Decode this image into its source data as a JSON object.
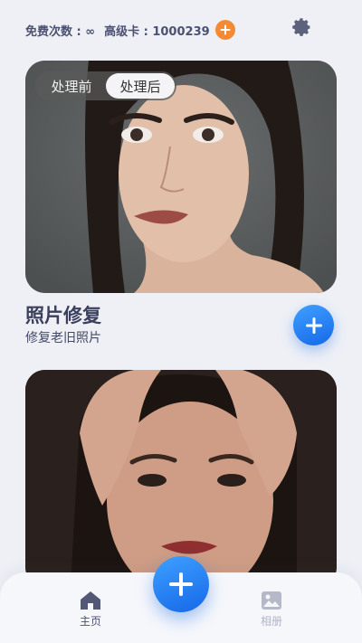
{
  "header": {
    "free_count_label": "免费次数 : ∞",
    "premium_card_label": "高级卡 : 1000239",
    "add_icon": "plus-icon",
    "settings_icon": "gear-icon"
  },
  "compare_toggle": {
    "options": [
      "处理前",
      "处理后"
    ],
    "active": "处理后"
  },
  "feature_card": {
    "title": "照片修复",
    "subtitle": "修复老旧照片",
    "add_icon": "plus-icon"
  },
  "bottom_nav": {
    "items": [
      {
        "label": "主页",
        "icon": "home-icon",
        "active": true
      },
      {
        "label": "相册",
        "icon": "gallery-icon",
        "active": false
      }
    ],
    "center_icon": "plus-icon"
  },
  "colors": {
    "accent_blue": "#1f7ef0",
    "accent_orange": "#f58a35",
    "background": "#eef0f6"
  }
}
